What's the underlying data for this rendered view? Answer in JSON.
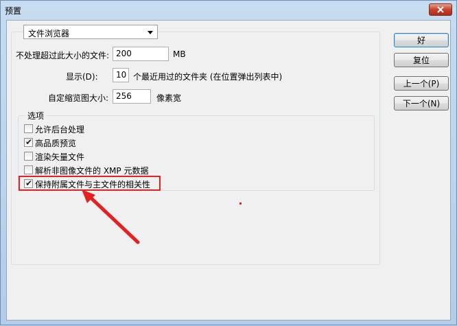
{
  "window": {
    "title": "预置"
  },
  "top": {
    "category_select": "文件浏览器",
    "no_process_label": "不处理超过此大小的文件:",
    "no_process_value": "200",
    "no_process_unit": "MB",
    "display_label": "显示(D):",
    "display_value": "10",
    "display_suffix": "个最近用过的文件夹 (在位置弹出列表中)",
    "thumb_label": "自定缩览图大小:",
    "thumb_value": "256",
    "thumb_unit": "像素宽"
  },
  "options": {
    "title": "选项",
    "items": [
      {
        "label": "允许后台处理",
        "checked": false
      },
      {
        "label": "高品质预览",
        "checked": true
      },
      {
        "label": "渲染矢量文件",
        "checked": false
      },
      {
        "label": "解析非图像文件的 XMP 元数据",
        "checked": false
      },
      {
        "label": "保持附属文件与主文件的相关性",
        "checked": true
      }
    ]
  },
  "buttons": {
    "ok": "好",
    "reset": "复位",
    "prev": "上一个(P)",
    "next": "下一个(N)"
  },
  "colors": {
    "highlight": "#e52020"
  }
}
